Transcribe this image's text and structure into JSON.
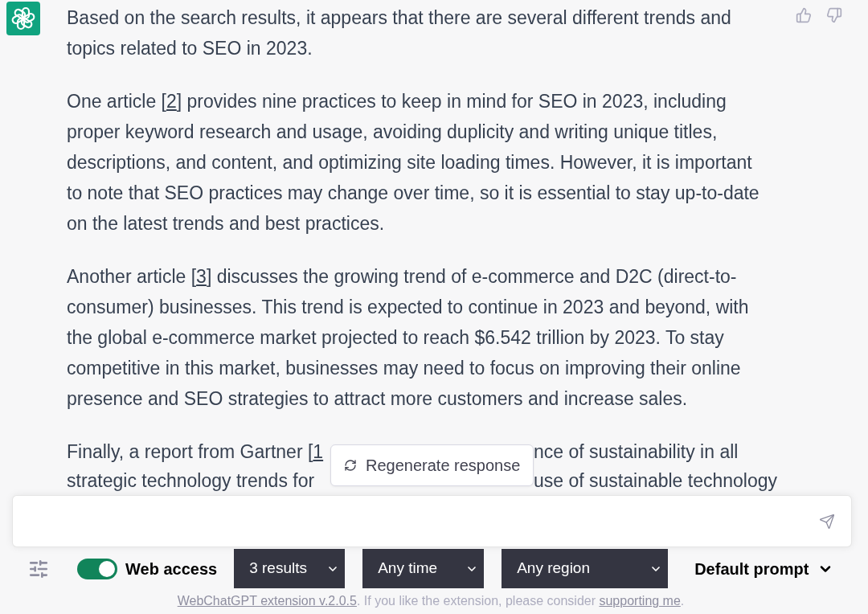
{
  "message": {
    "paragraphs": [
      {
        "segments": [
          {
            "kind": "text",
            "text": "Based on the search results, it appears that there are several different trends and topics related to SEO in 2023."
          }
        ]
      },
      {
        "segments": [
          {
            "kind": "text",
            "text": "One article ["
          },
          {
            "kind": "link",
            "text": "2"
          },
          {
            "kind": "text",
            "text": "] provides nine practices to keep in mind for SEO in 2023, including proper keyword research and usage, avoiding duplicity and writing unique titles, descriptions, and content, and optimizing site loading times. However, it is important to note that SEO practices may change over time, so it is essential to stay up-to-date on the latest trends and best practices."
          }
        ]
      },
      {
        "segments": [
          {
            "kind": "text",
            "text": "Another article ["
          },
          {
            "kind": "link",
            "text": "3"
          },
          {
            "kind": "text",
            "text": "] discusses the growing trend of e-commerce and D2C (direct-to-consumer) businesses. This trend is expected to continue in 2023 and beyond, with the global e-commerce market projected to reach $6.542 trillion by 2023. To stay competitive in this market, businesses may need to focus on improving their online presence and SEO strategies to attract more customers and increase sales."
          }
        ]
      }
    ],
    "partial_paragraph": {
      "lines": [
        {
          "left": [
            {
              "kind": "text",
              "text": "Finally, a report from Gartner ["
            },
            {
              "kind": "link",
              "text": "1"
            }
          ],
          "right": "nce of sustainability in all"
        },
        {
          "left": [
            {
              "kind": "text",
              "text": "strategic technology trends for"
            }
          ],
          "right": "use of sustainable technology"
        }
      ]
    }
  },
  "regenerate_button": {
    "label": "Regenerate response"
  },
  "toolbar": {
    "web_access": {
      "label": "Web access",
      "on": true
    },
    "dropdowns": [
      {
        "value": "3 results"
      },
      {
        "value": "Any time"
      },
      {
        "value": "Any region"
      }
    ],
    "prompt_menu": {
      "label": "Default prompt"
    }
  },
  "footer": {
    "segments": [
      {
        "kind": "link",
        "text": "WebChatGPT extension v.2.0.5"
      },
      {
        "kind": "text",
        "text": ". If you like the extension, please consider "
      },
      {
        "kind": "link",
        "text": "supporting me"
      },
      {
        "kind": "text",
        "text": "."
      }
    ]
  }
}
